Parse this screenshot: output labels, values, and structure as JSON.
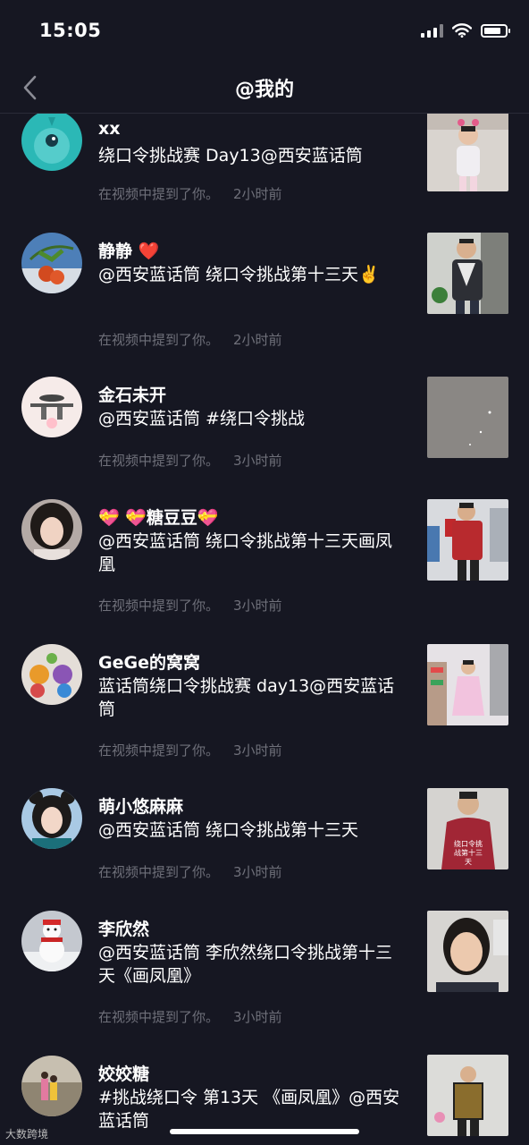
{
  "status": {
    "time": "15:05"
  },
  "nav": {
    "title": "@我的"
  },
  "mention_text": "在视频中提到了你。",
  "items": [
    {
      "name": "xx",
      "message": "绕口令挑战赛 Day13@西安蓝话筒",
      "time": "2小时前"
    },
    {
      "name": "静静 ❤️",
      "message": "@西安蓝话筒 绕口令挑战第十三天✌️",
      "time": "2小时前"
    },
    {
      "name": "金石未开",
      "message": "@西安蓝话筒 #绕口令挑战",
      "time": "3小时前"
    },
    {
      "name": "💝 💝糖豆豆💝",
      "message": "@西安蓝话筒 绕口令挑战第十三天画凤凰",
      "time": "3小时前"
    },
    {
      "name": "GeGe的窝窝",
      "message": "蓝话筒绕口令挑战赛 day13@西安蓝话筒",
      "time": "3小时前"
    },
    {
      "name": "萌小悠麻麻",
      "message": "@西安蓝话筒 绕口令挑战第十三天",
      "time": "3小时前",
      "thumb_caption": "绕口令挑战第十三天"
    },
    {
      "name": "李欣然",
      "message": "@西安蓝话筒 李欣然绕口令挑战第十三天《画凤凰》",
      "time": "3小时前"
    },
    {
      "name": "姣姣糖",
      "message": "#挑战绕口令 第13天 《画凤凰》@西安蓝话筒",
      "time": ""
    }
  ],
  "watermark": "大数跨境"
}
